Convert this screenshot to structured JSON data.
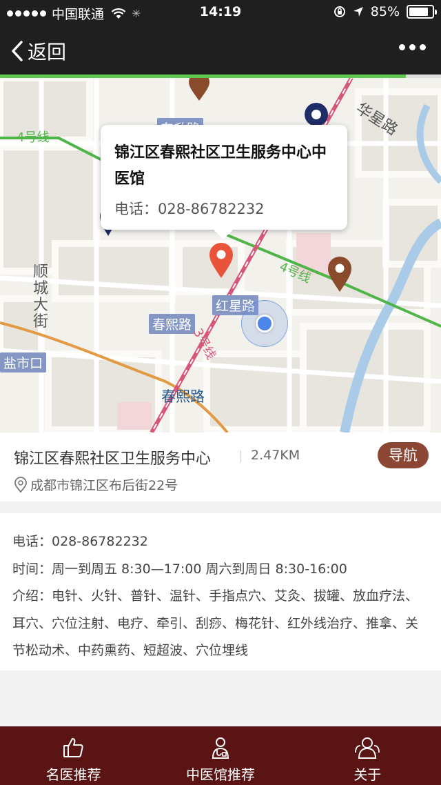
{
  "status_bar": {
    "carrier": "中国联通",
    "time": "14:19",
    "battery_percent": "85%",
    "battery_level": 0.85
  },
  "nav": {
    "back_label": "返回",
    "progress": 0.92
  },
  "map": {
    "labels": {
      "line4_top": "4号线",
      "line4_mid": "4号线",
      "huaxing_road": "华星路",
      "shuncheng_street": "顺\n城\n大\n街",
      "hongxing_road": "红星路",
      "chunxi_road_tag": "春熙路",
      "chunxi_road": "春熙路",
      "line3": "3号线",
      "yanshi_kou": "盐市口",
      "partial_road": "东升路"
    },
    "popup": {
      "title": "锦江区春熙社区卫生服务中心中医馆",
      "phone": "电话：028-86782232"
    }
  },
  "place": {
    "name": "锦江区春熙社区卫生服务中心",
    "distance": "2.47KM",
    "navigate_label": "导航",
    "address": "成都市锦江区布后街22号"
  },
  "details": {
    "phone": "电话：028-86782232",
    "hours": "时间：周一到周五 8:30—17:00 周六到周日 8:30-16:00",
    "intro": "介绍：电针、火针、普针、温针、手指点穴、艾灸、拔罐、放血疗法、耳穴、穴位注射、电疗、牵引、刮痧、梅花针、红外线治疗、推拿、关节松动术、中药熏药、短超波、穴位埋线"
  },
  "tabs": [
    {
      "label": "名医推荐",
      "icon": "thumbs-up-icon"
    },
    {
      "label": "中医馆推荐",
      "icon": "doctor-icon"
    },
    {
      "label": "关于",
      "icon": "people-icon"
    }
  ],
  "colors": {
    "accent_brown": "#8b4634",
    "tabbar_bg": "#5a1414",
    "progress_green": "#5ec84e",
    "pin_red": "#e9533a",
    "pin_brown": "#8a4a2c",
    "pin_navy": "#1f2d66"
  }
}
